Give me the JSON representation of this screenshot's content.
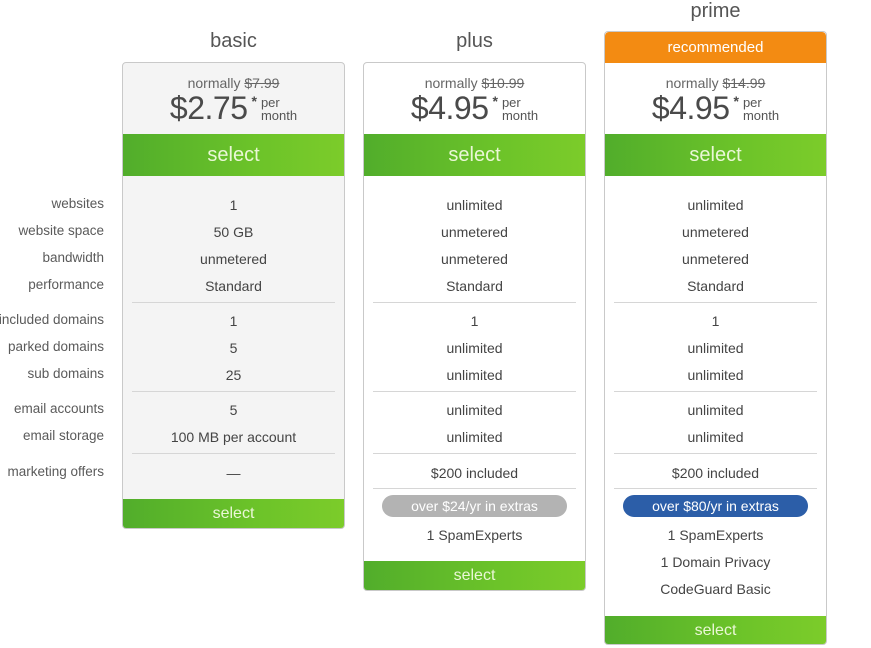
{
  "feature_labels": [
    "websites",
    "website space",
    "bandwidth",
    "performance",
    "included domains",
    "parked domains",
    "sub domains",
    "email accounts",
    "email storage",
    "marketing offers"
  ],
  "plans": [
    {
      "name": "basic",
      "normally_label": "normally",
      "old_price": "$7.99",
      "price": "$2.75",
      "asterisk": "*",
      "per": "per",
      "month": "month",
      "select_label": "select",
      "features": [
        "1",
        "50 GB",
        "unmetered",
        "Standard",
        "1",
        "5",
        "25",
        "5",
        "100 MB per account",
        "—"
      ],
      "extras_badge": null,
      "extras": []
    },
    {
      "name": "plus",
      "normally_label": "normally",
      "old_price": "$10.99",
      "price": "$4.95",
      "asterisk": "*",
      "per": "per",
      "month": "month",
      "select_label": "select",
      "features": [
        "unlimited",
        "unmetered",
        "unmetered",
        "Standard",
        "1",
        "unlimited",
        "unlimited",
        "unlimited",
        "unlimited",
        "$200 included"
      ],
      "extras_badge": "over $24/yr in extras",
      "extras": [
        "1 SpamExperts"
      ]
    },
    {
      "name": "prime",
      "ribbon": "recommended",
      "normally_label": "normally",
      "old_price": "$14.99",
      "price": "$4.95",
      "asterisk": "*",
      "per": "per",
      "month": "month",
      "select_label": "select",
      "features": [
        "unlimited",
        "unmetered",
        "unmetered",
        "Standard",
        "1",
        "unlimited",
        "unlimited",
        "unlimited",
        "unlimited",
        "$200 included"
      ],
      "extras_badge": "over $80/yr in extras",
      "extras": [
        "1 SpamExperts",
        "1 Domain Privacy",
        "CodeGuard Basic"
      ]
    }
  ],
  "colors": {
    "select_green": "#6cc329",
    "ribbon_orange": "#f38b12",
    "badge_gray": "#b3b3b3",
    "badge_blue": "#2c5ea8"
  }
}
